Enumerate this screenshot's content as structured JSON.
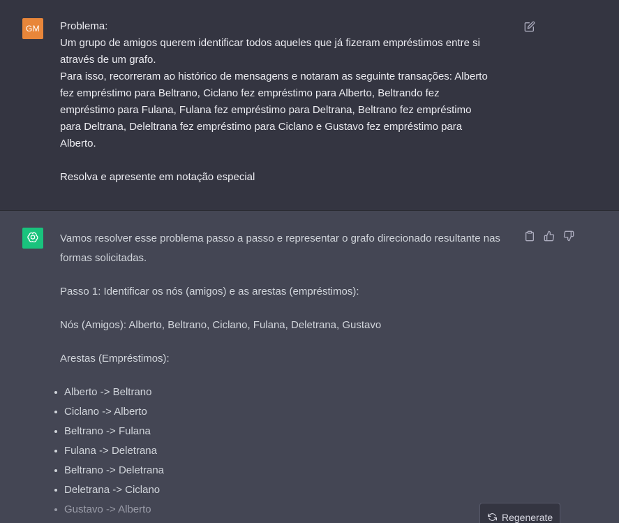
{
  "user_message": {
    "avatar_initials": "GM",
    "lines": [
      "Problema:",
      "Um grupo de amigos querem identificar todos aqueles que já fizeram empréstimos entre si",
      "através de um grafo.",
      "Para isso, recorreram ao histórico de mensagens e notaram as seguinte transações: Alberto",
      "fez empréstimo para Beltrano, Ciclano fez empréstimo para Alberto, Beltrando fez",
      "empréstimo para Fulana, Fulana fez empréstimo para Deltrana, Beltrano fez empréstimo",
      "para Deltrana, Deleltrana fez empréstimo para Ciclano e Gustavo fez empréstimo para",
      "Alberto."
    ],
    "final_line": "Resolva e apresente em notação especial"
  },
  "assistant_message": {
    "paragraphs": [
      "Vamos resolver esse problema passo a passo e representar o grafo direcionado resultante nas formas solicitadas.",
      "Passo 1: Identificar os nós (amigos) e as arestas (empréstimos):",
      "Nós (Amigos): Alberto, Beltrano, Ciclano, Fulana, Deletrana, Gustavo",
      "Arestas (Empréstimos):"
    ],
    "edges": [
      "Alberto -> Beltrano",
      "Ciclano -> Alberto",
      "Beltrano -> Fulana",
      "Fulana -> Deletrana",
      "Beltrano -> Deletrana",
      "Deletrana -> Ciclano",
      "Gustavo -> Alberto"
    ]
  },
  "actions": {
    "regenerate_label": "Regenerate"
  },
  "icons": {
    "edit": "edit-icon",
    "copy": "clipboard-icon",
    "like": "thumbs-up-icon",
    "dislike": "thumbs-down-icon",
    "regenerate": "refresh-icon",
    "assistant_logo": "openai-logo-icon"
  },
  "colors": {
    "user_bg": "#343541",
    "assistant_bg": "#444654",
    "user_avatar": "#e8863a",
    "assistant_avatar": "#19c37d"
  }
}
